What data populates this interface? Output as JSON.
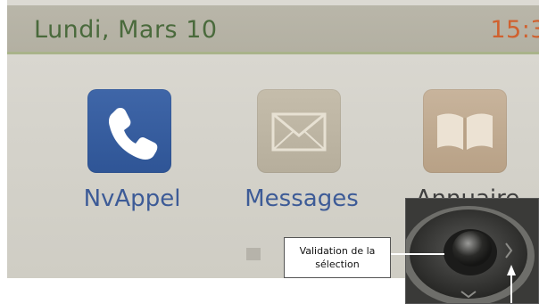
{
  "status_bar": {
    "date": "Lundi, Mars 10",
    "time": "15:3"
  },
  "apps": [
    {
      "label": "NvAppel",
      "icon": "phone-handset-icon"
    },
    {
      "label": "Messages",
      "icon": "envelope-icon"
    },
    {
      "label": "Annuaire",
      "icon": "open-book-icon"
    }
  ],
  "page_indicator": {
    "icon": "page-dot-icon"
  },
  "callout": {
    "line1": "Validation de la",
    "line2": "sélection"
  },
  "colors": {
    "date_text": "#4a6a3c",
    "time_text": "#d0612f",
    "app_label": "#3d5b97",
    "phone_tile": "#2f5596"
  }
}
